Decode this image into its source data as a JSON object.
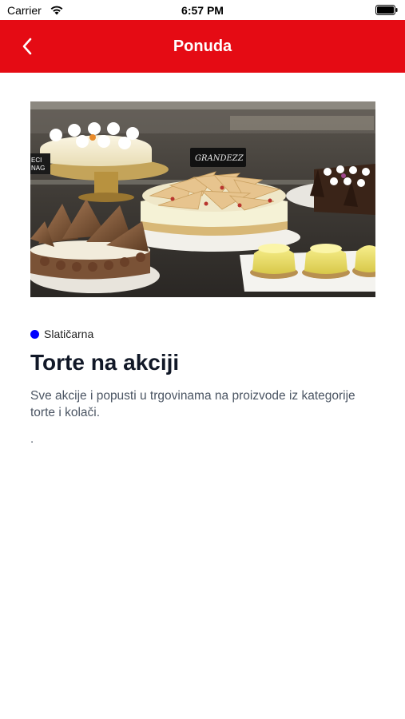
{
  "status_bar": {
    "carrier": "Carrier",
    "time": "6:57 PM"
  },
  "nav": {
    "title": "Ponuda",
    "back_icon": "chevron-left-icon",
    "color": "#e50b14"
  },
  "offer": {
    "image_sign_text": "GRANDEZZ",
    "image_sign_left_text": "ECI\nNAG",
    "category": "Slatičarna",
    "category_color": "#0000ff",
    "title": "Torte na akciji",
    "description": "Sve akcije i popusti u trgovinama na proizvode iz kategorije torte i kolači.",
    "footnote": "."
  }
}
